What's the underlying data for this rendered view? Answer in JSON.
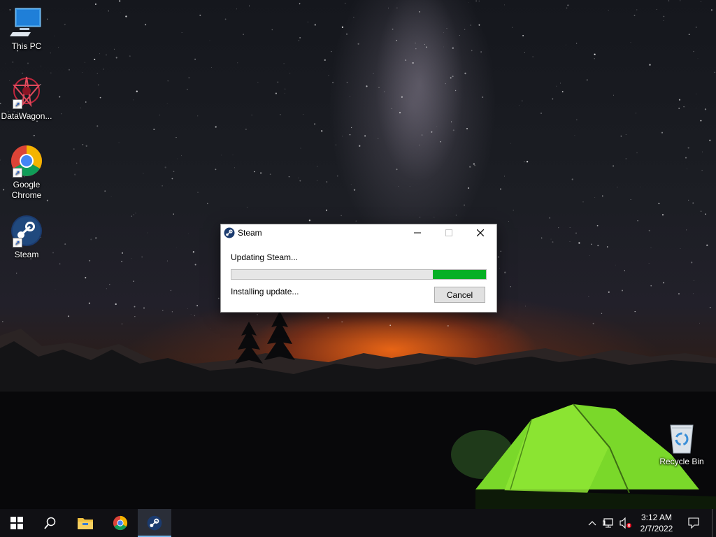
{
  "desktop": {
    "icons": [
      {
        "label": "This PC",
        "icon": "computer-icon"
      },
      {
        "label": "DataWagon...",
        "icon": "datawagon-icon"
      },
      {
        "label": "Google\nChrome",
        "icon": "chrome-icon"
      },
      {
        "label": "Steam",
        "icon": "steam-icon"
      },
      {
        "label": "Recycle Bin",
        "icon": "recycle-bin-icon"
      }
    ]
  },
  "dialog": {
    "title": "Steam",
    "status": "Updating Steam...",
    "progress_percent": 21,
    "detail": "Installing update...",
    "cancel_label": "Cancel",
    "progress_color": "#06b025"
  },
  "taskbar": {
    "pinned": [
      "start-icon",
      "search-icon",
      "file-explorer-icon",
      "chrome-icon",
      "steam-icon"
    ],
    "active": "steam-icon",
    "clock": {
      "time": "3:12 AM",
      "date": "2/7/2022"
    },
    "tray": [
      "chevron-up-icon",
      "network-icon",
      "volume-muted-icon",
      "notifications-icon"
    ]
  },
  "colors": {
    "taskbar_bg": "#101014",
    "accent": "#76b9ed"
  }
}
